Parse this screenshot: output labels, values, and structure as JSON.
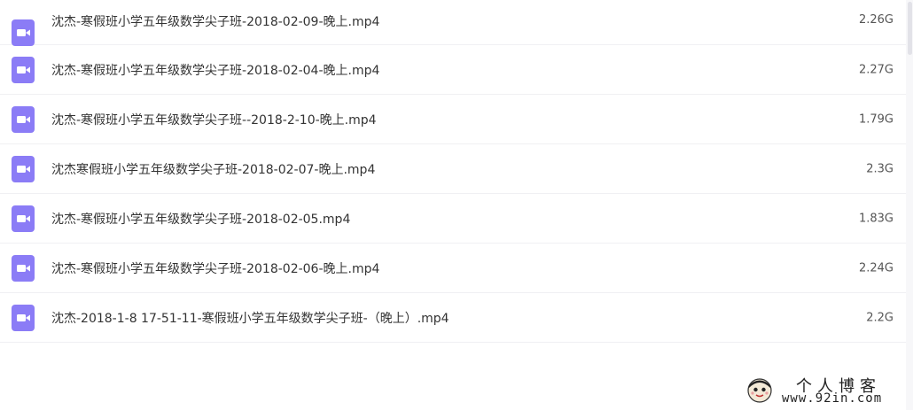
{
  "files": [
    {
      "name": "沈杰-寒假班小学五年级数学尖子班-2018-02-09-晚上.mp4",
      "size": "2.26G",
      "icon": "video-file-icon"
    },
    {
      "name": "沈杰-寒假班小学五年级数学尖子班-2018-02-04-晚上.mp4",
      "size": "2.27G",
      "icon": "video-file-icon"
    },
    {
      "name": "沈杰-寒假班小学五年级数学尖子班--2018-2-10-晚上.mp4",
      "size": "1.79G",
      "icon": "video-file-icon"
    },
    {
      "name": "沈杰寒假班小学五年级数学尖子班-2018-02-07-晚上.mp4",
      "size": "2.3G",
      "icon": "video-file-icon"
    },
    {
      "name": "沈杰-寒假班小学五年级数学尖子班-2018-02-05.mp4",
      "size": "1.83G",
      "icon": "video-file-icon"
    },
    {
      "name": "沈杰-寒假班小学五年级数学尖子班-2018-02-06-晚上.mp4",
      "size": "2.24G",
      "icon": "video-file-icon"
    },
    {
      "name": "沈杰-2018-1-8 17-51-11-寒假班小学五年级数学尖子班-（晚上）.mp4",
      "size": "2.2G",
      "icon": "video-file-icon"
    }
  ],
  "watermark": {
    "title": "个人博客",
    "url": "www.92in.com"
  },
  "colors": {
    "icon_bg": "#8b7cf6",
    "icon_fg": "#ffffff",
    "divider": "#f0f0f3"
  }
}
